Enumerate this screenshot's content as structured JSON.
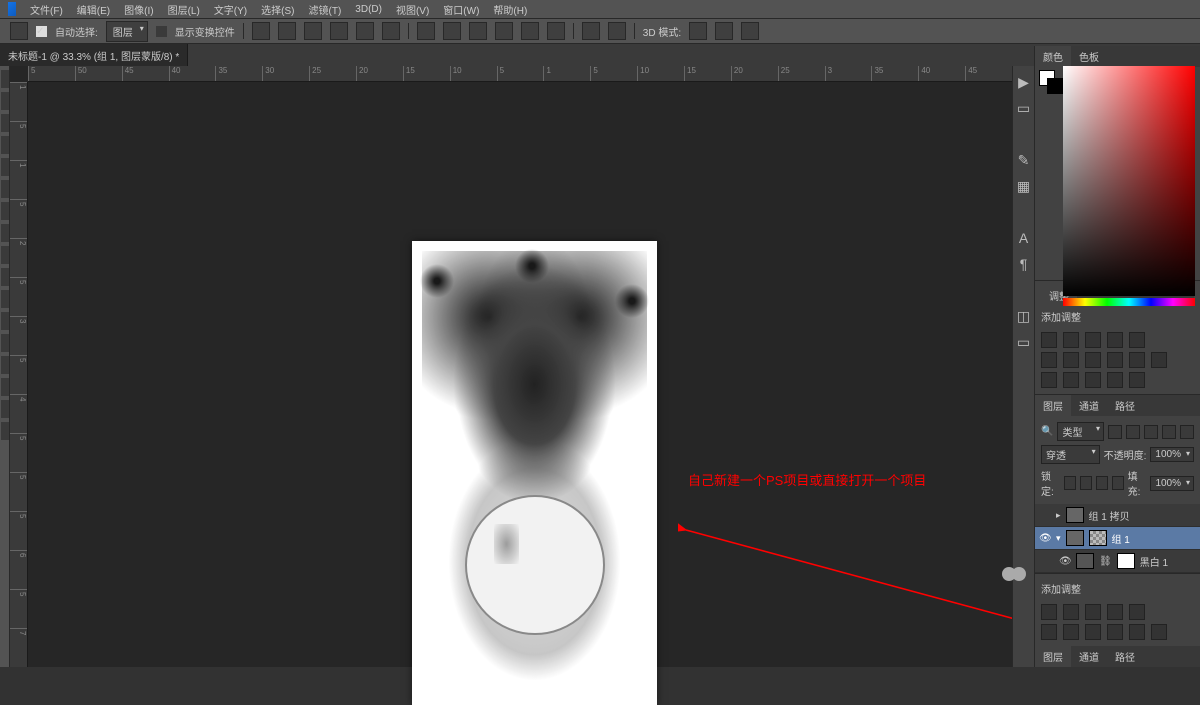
{
  "menu": {
    "file": "文件(F)",
    "edit": "编辑(E)",
    "image": "图像(I)",
    "layer": "图层(L)",
    "type": "文字(Y)",
    "select": "选择(S)",
    "filter": "滤镜(T)",
    "3d": "3D(D)",
    "view": "视图(V)",
    "window": "窗口(W)",
    "help": "帮助(H)"
  },
  "options": {
    "auto_select_checkbox": true,
    "auto_select_label": "自动选择:",
    "auto_select_mode": "图层",
    "show_transform_label": "显示变换控件",
    "mode_3d": "3D 模式:"
  },
  "document": {
    "tab_title": "未标题-1 @ 33.3% (组 1, 图层蒙版/8) *"
  },
  "ruler_h": [
    "5",
    "50",
    "45",
    "40",
    "35",
    "30",
    "25",
    "20",
    "15",
    "10",
    "5",
    "1",
    "5",
    "10",
    "15",
    "20",
    "25",
    "3",
    "35",
    "40",
    "45"
  ],
  "ruler_v": [
    "1",
    "5",
    "1",
    "5",
    "2",
    "5",
    "3",
    "5",
    "4",
    "5",
    "5",
    "5",
    "6",
    "5",
    "7"
  ],
  "annotation": {
    "text": "自己新建一个PS项目或直接打开一个项目"
  },
  "panels": {
    "color": {
      "tab1": "颜色",
      "tab2": "色板"
    },
    "adjust": {
      "tab": "调整",
      "title": "添加调整"
    },
    "layers": {
      "tab1": "图层",
      "tab2": "通道",
      "tab3": "路径",
      "kind_label": "类型",
      "blend_mode": "穿透",
      "opacity_label": "不透明度:",
      "opacity_value": "100%",
      "lock_label": "锁定:",
      "fill_label": "填充:",
      "fill_value": "100%",
      "items": [
        {
          "name": "组 1 拷贝"
        },
        {
          "name": "组 1"
        },
        {
          "name": "黑白 1"
        }
      ]
    }
  },
  "icons": {
    "search": "🔍",
    "history": "▶",
    "styles": "▭",
    "char": "A",
    "para": "¶",
    "cube": "◫",
    "brush": "✎",
    "swatch": "▦"
  }
}
